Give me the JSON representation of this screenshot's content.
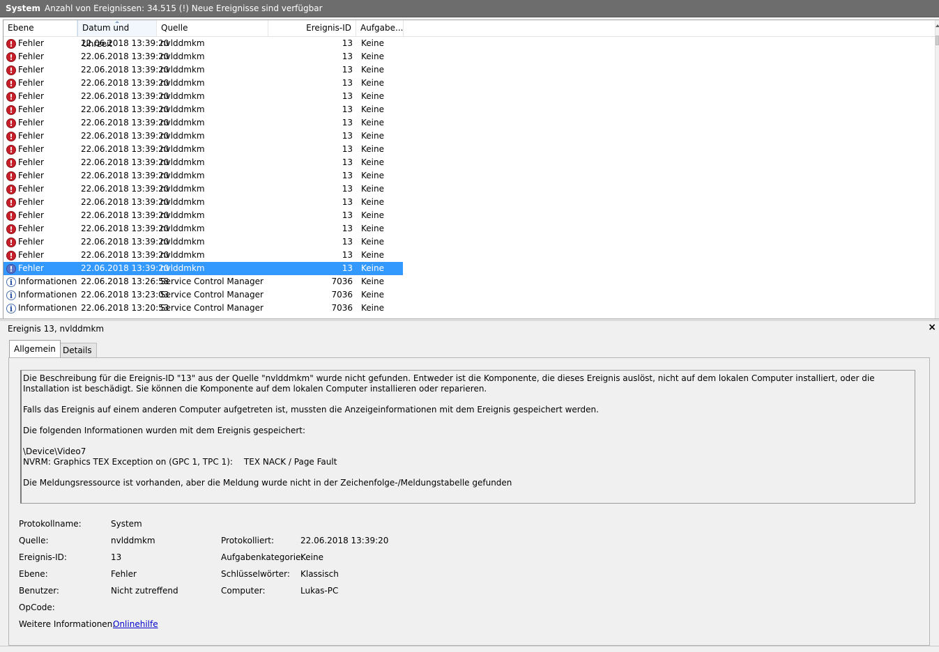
{
  "topbar": {
    "log_name": "System",
    "status": "Anzahl von Ereignissen: 34.515 (!) Neue Ereignisse sind verfügbar"
  },
  "columns": {
    "level": "Ebene",
    "datetime": "Datum und Uhrzeit",
    "source": "Quelle",
    "event_id": "Ereignis-ID",
    "task": "Aufgabe..."
  },
  "events": [
    {
      "level": "Fehler",
      "type": "error",
      "datetime": "22.06.2018 13:39:20",
      "source": "nvlddmkm",
      "id": "13",
      "task": "Keine"
    },
    {
      "level": "Fehler",
      "type": "error",
      "datetime": "22.06.2018 13:39:20",
      "source": "nvlddmkm",
      "id": "13",
      "task": "Keine"
    },
    {
      "level": "Fehler",
      "type": "error",
      "datetime": "22.06.2018 13:39:20",
      "source": "nvlddmkm",
      "id": "13",
      "task": "Keine"
    },
    {
      "level": "Fehler",
      "type": "error",
      "datetime": "22.06.2018 13:39:20",
      "source": "nvlddmkm",
      "id": "13",
      "task": "Keine"
    },
    {
      "level": "Fehler",
      "type": "error",
      "datetime": "22.06.2018 13:39:20",
      "source": "nvlddmkm",
      "id": "13",
      "task": "Keine"
    },
    {
      "level": "Fehler",
      "type": "error",
      "datetime": "22.06.2018 13:39:20",
      "source": "nvlddmkm",
      "id": "13",
      "task": "Keine"
    },
    {
      "level": "Fehler",
      "type": "error",
      "datetime": "22.06.2018 13:39:20",
      "source": "nvlddmkm",
      "id": "13",
      "task": "Keine"
    },
    {
      "level": "Fehler",
      "type": "error",
      "datetime": "22.06.2018 13:39:20",
      "source": "nvlddmkm",
      "id": "13",
      "task": "Keine"
    },
    {
      "level": "Fehler",
      "type": "error",
      "datetime": "22.06.2018 13:39:20",
      "source": "nvlddmkm",
      "id": "13",
      "task": "Keine"
    },
    {
      "level": "Fehler",
      "type": "error",
      "datetime": "22.06.2018 13:39:20",
      "source": "nvlddmkm",
      "id": "13",
      "task": "Keine"
    },
    {
      "level": "Fehler",
      "type": "error",
      "datetime": "22.06.2018 13:39:20",
      "source": "nvlddmkm",
      "id": "13",
      "task": "Keine"
    },
    {
      "level": "Fehler",
      "type": "error",
      "datetime": "22.06.2018 13:39:20",
      "source": "nvlddmkm",
      "id": "13",
      "task": "Keine"
    },
    {
      "level": "Fehler",
      "type": "error",
      "datetime": "22.06.2018 13:39:20",
      "source": "nvlddmkm",
      "id": "13",
      "task": "Keine"
    },
    {
      "level": "Fehler",
      "type": "error",
      "datetime": "22.06.2018 13:39:20",
      "source": "nvlddmkm",
      "id": "13",
      "task": "Keine"
    },
    {
      "level": "Fehler",
      "type": "error",
      "datetime": "22.06.2018 13:39:20",
      "source": "nvlddmkm",
      "id": "13",
      "task": "Keine"
    },
    {
      "level": "Fehler",
      "type": "error",
      "datetime": "22.06.2018 13:39:20",
      "source": "nvlddmkm",
      "id": "13",
      "task": "Keine"
    },
    {
      "level": "Fehler",
      "type": "error",
      "datetime": "22.06.2018 13:39:20",
      "source": "nvlddmkm",
      "id": "13",
      "task": "Keine"
    },
    {
      "level": "Fehler",
      "type": "error",
      "datetime": "22.06.2018 13:39:20",
      "source": "nvlddmkm",
      "id": "13",
      "task": "Keine",
      "selected": true
    },
    {
      "level": "Informationen",
      "type": "info",
      "datetime": "22.06.2018 13:26:58",
      "source": "Service Control Manager",
      "id": "7036",
      "task": "Keine"
    },
    {
      "level": "Informationen",
      "type": "info",
      "datetime": "22.06.2018 13:23:03",
      "source": "Service Control Manager",
      "id": "7036",
      "task": "Keine"
    },
    {
      "level": "Informationen",
      "type": "info",
      "datetime": "22.06.2018 13:20:53",
      "source": "Service Control Manager",
      "id": "7036",
      "task": "Keine"
    }
  ],
  "detail": {
    "title": "Ereignis 13, nvlddmkm",
    "close": "×",
    "tabs": {
      "general": "Allgemein",
      "details": "Details"
    },
    "message": {
      "p1": "Die Beschreibung für die Ereignis-ID \"13\" aus der Quelle \"nvlddmkm\" wurde nicht gefunden. Entweder ist die Komponente, die dieses Ereignis auslöst, nicht auf dem lokalen Computer installiert, oder die Installation ist beschädigt. Sie können die Komponente auf dem lokalen Computer installieren oder reparieren.",
      "p2": "Falls das Ereignis auf einem anderen Computer aufgetreten ist, mussten die Anzeigeinformationen mit dem Ereignis gespeichert werden.",
      "p3": "Die folgenden Informationen wurden mit dem Ereignis gespeichert:",
      "device": "\\Device\\Video7",
      "nvrm": "NVRM: Graphics TEX Exception on (GPC 1, TPC 1):",
      "nvrm_detail": "TEX NACK / Page Fault",
      "p5": "Die Meldungsressource ist vorhanden, aber die Meldung wurde nicht in der Zeichenfolge-/Meldungstabelle gefunden"
    },
    "props": {
      "log_name_label": "Protokollname:",
      "log_name": "System",
      "source_label": "Quelle:",
      "source": "nvlddmkm",
      "logged_label": "Protokolliert:",
      "logged": "22.06.2018 13:39:20",
      "event_id_label": "Ereignis-ID:",
      "event_id": "13",
      "task_label": "Aufgabenkategorie:",
      "task": "Keine",
      "level_label": "Ebene:",
      "level": "Fehler",
      "keywords_label": "Schlüsselwörter:",
      "keywords": "Klassisch",
      "user_label": "Benutzer:",
      "user": "Nicht zutreffend",
      "computer_label": "Computer:",
      "computer": "Lukas-PC",
      "opcode_label": "OpCode:",
      "more_label": "Weitere Informationen:",
      "more_link": "Onlinehilfe"
    }
  }
}
